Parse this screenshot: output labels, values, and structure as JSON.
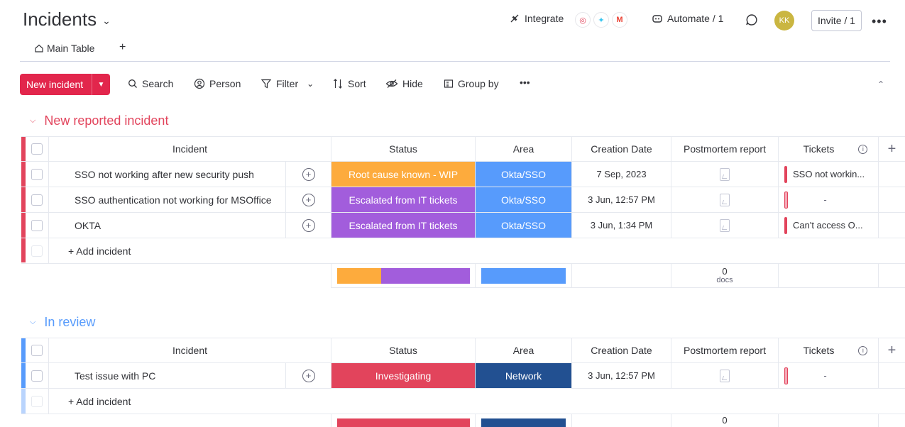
{
  "header": {
    "title": "Incidents",
    "integrate_label": "Integrate",
    "automate_label": "Automate / 1",
    "avatar_initials": "KK",
    "invite_label": "Invite / 1",
    "more_glyph": "•••"
  },
  "tabs": {
    "main_table_label": "Main Table",
    "add_glyph": "+"
  },
  "toolbar": {
    "new_label": "New incident",
    "search_label": "Search",
    "person_label": "Person",
    "filter_label": "Filter",
    "sort_label": "Sort",
    "hide_label": "Hide",
    "groupby_label": "Group by",
    "more_glyph": "•••"
  },
  "columns": {
    "incident": "Incident",
    "status": "Status",
    "area": "Area",
    "creation_date": "Creation Date",
    "postmortem": "Postmortem report",
    "tickets": "Tickets"
  },
  "groups": [
    {
      "title": "New reported incident",
      "color": "#e2445c",
      "add_label": "+ Add incident",
      "docs_count": "0",
      "docs_label": "docs",
      "rows": [
        {
          "name": "SSO not working after new security push",
          "status": "Root cause known - WIP",
          "status_color": "#fdab3d",
          "area": "Okta/SSO",
          "area_color": "#579bfc",
          "date": "7 Sep, 2023",
          "ticket": "SSO not workin..."
        },
        {
          "name": "SSO authentication not working for MSOffice",
          "status": "Escalated from IT tickets",
          "status_color": "#a25ddc",
          "area": "Okta/SSO",
          "area_color": "#579bfc",
          "date": "3 Jun, 12:57 PM",
          "ticket": "-"
        },
        {
          "name": "OKTA",
          "status": "Escalated from IT tickets",
          "status_color": "#a25ddc",
          "area": "Okta/SSO",
          "area_color": "#579bfc",
          "date": "3 Jun, 1:34 PM",
          "ticket": "Can't access O..."
        }
      ]
    },
    {
      "title": "In review",
      "color": "#579bfc",
      "add_label": "+ Add incident",
      "docs_count": "0",
      "rows": [
        {
          "name": "Test issue with PC",
          "status": "Investigating",
          "status_color": "#e2445c",
          "area": "Network",
          "area_color": "#225091",
          "date": "3 Jun, 12:57 PM",
          "ticket": "-"
        }
      ]
    }
  ]
}
